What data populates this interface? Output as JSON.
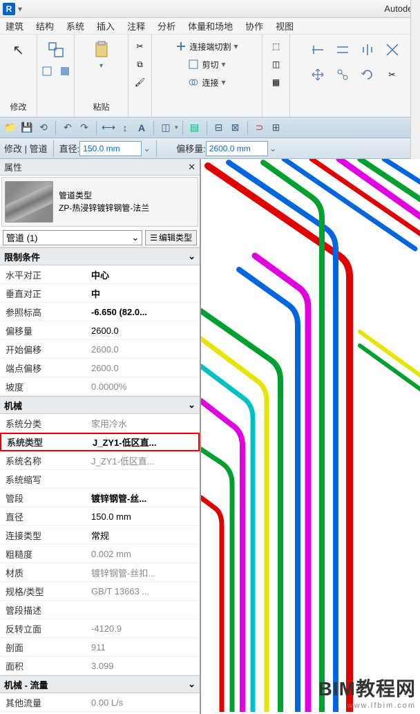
{
  "app": {
    "icon_letter": "R",
    "title": "Autodes"
  },
  "menu": [
    "建筑",
    "结构",
    "系统",
    "插入",
    "注释",
    "分析",
    "体量和场地",
    "协作",
    "视图"
  ],
  "ribbon": {
    "modify_label": "修改",
    "paste_label": "粘贴",
    "cut_label": "连接端切割",
    "trim_label": "剪切",
    "join_label": "连接"
  },
  "options": {
    "context": "修改 | 管道",
    "diameter_label": "直径:",
    "diameter_value": "150.0 mm",
    "offset_label": "偏移量:",
    "offset_value": "2600.0 mm"
  },
  "props": {
    "title": "属性",
    "type_family": "管道类型",
    "type_name": "ZP-热浸锌镀锌钢管-法兰",
    "filter": "管道 (1)",
    "edit_type": "编辑类型",
    "groups": {
      "constraints": "限制条件",
      "mechanical": "机械",
      "mech_flow": "机械 - 流量"
    },
    "rows": {
      "h_just": {
        "l": "水平对正",
        "v": "中心"
      },
      "v_just": {
        "l": "垂直对正",
        "v": "中"
      },
      "ref_level": {
        "l": "参照标高",
        "v": "-6.650 (82.0..."
      },
      "offset": {
        "l": "偏移量",
        "v": "2600.0"
      },
      "start_off": {
        "l": "开始偏移",
        "v": "2600.0"
      },
      "end_off": {
        "l": "端点偏移",
        "v": "2600.0"
      },
      "slope": {
        "l": "坡度",
        "v": "0.0000%"
      },
      "sys_class": {
        "l": "系统分类",
        "v": "家用冷水"
      },
      "sys_type": {
        "l": "系统类型",
        "v": "J_ZY1-低区直..."
      },
      "sys_name": {
        "l": "系统名称",
        "v": "J_ZY1-低区直..."
      },
      "sys_abbr": {
        "l": "系统缩写",
        "v": ""
      },
      "segment": {
        "l": "管段",
        "v": "镀锌钢管-丝..."
      },
      "diameter": {
        "l": "直径",
        "v": "150.0 mm"
      },
      "conn_type": {
        "l": "连接类型",
        "v": "常规"
      },
      "roughness": {
        "l": "粗糙度",
        "v": "0.002 mm"
      },
      "material": {
        "l": "材质",
        "v": "镀锌钢管-丝扣..."
      },
      "spec": {
        "l": "规格/类型",
        "v": "GB/T 13663 ..."
      },
      "seg_desc": {
        "l": "管段描述",
        "v": ""
      },
      "inv_elev": {
        "l": "反转立面",
        "v": "-4120.9"
      },
      "section": {
        "l": "剖面",
        "v": "911"
      },
      "area": {
        "l": "面积",
        "v": "3.099"
      },
      "other_flow": {
        "l": "其他流量",
        "v": "0.00 L/s"
      }
    }
  },
  "watermark": {
    "big": "BIM教程网",
    "small": "www.lfbim.com"
  }
}
